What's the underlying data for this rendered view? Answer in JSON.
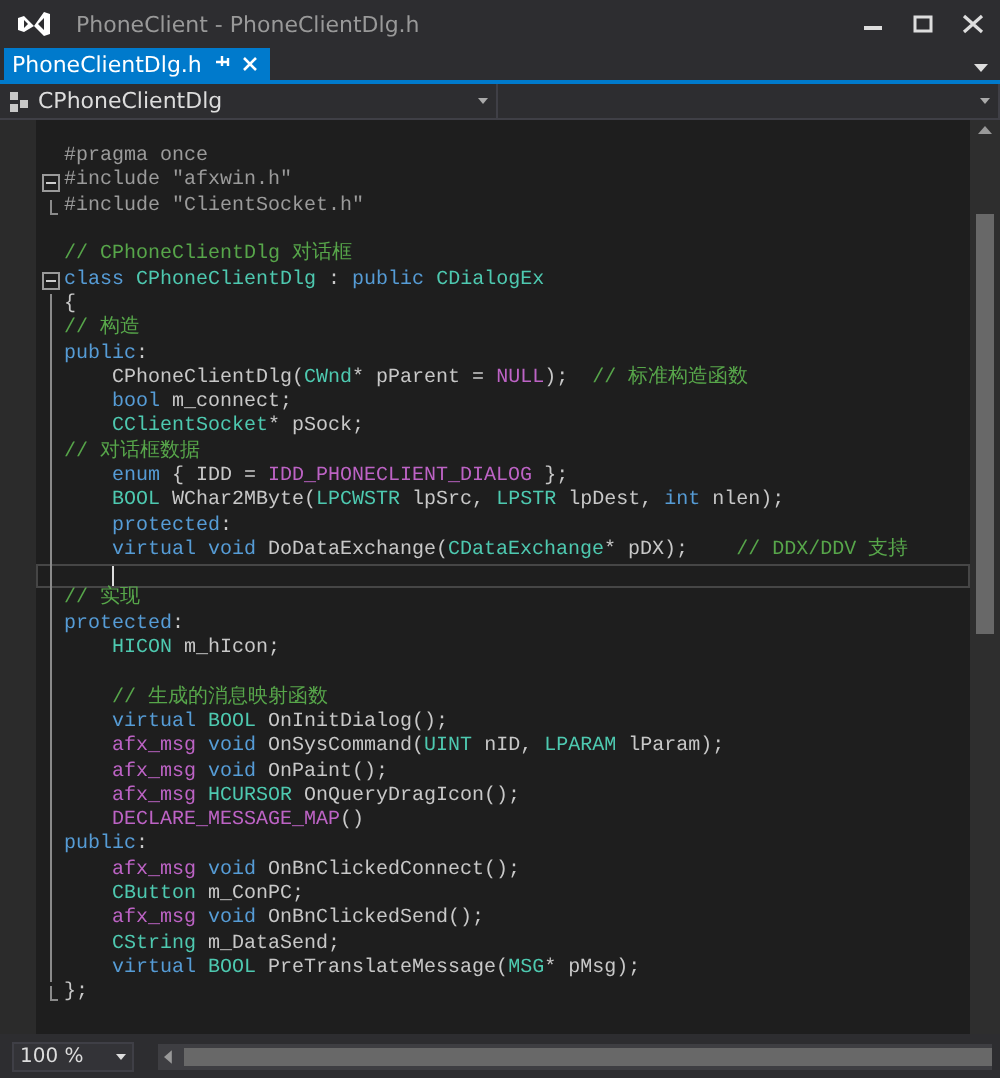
{
  "window": {
    "title": "PhoneClient - PhoneClientDlg.h"
  },
  "tabs": [
    {
      "label": "PhoneClientDlg.h",
      "selected": true,
      "pinned": false
    }
  ],
  "navigation": {
    "scope": "CPhoneClientDlg"
  },
  "editor": {
    "lines": [
      {
        "kind": "plain",
        "current": false,
        "segments": [
          {
            "kind": "pre",
            "text": "#pragma once"
          }
        ]
      },
      {
        "kind": "foldstart",
        "current": false,
        "segments": [
          {
            "kind": "pre",
            "text": "#include \"afxwin.h\""
          }
        ]
      },
      {
        "kind": "foldend",
        "current": false,
        "segments": [
          {
            "kind": "pre",
            "text": "#include \"ClientSocket.h\""
          }
        ]
      },
      {
        "kind": "plain",
        "current": false
      },
      {
        "kind": "plain",
        "current": false,
        "segments": [
          {
            "kind": "comment",
            "text": "// CPhoneClientDlg 对话框"
          }
        ]
      },
      {
        "kind": "foldstart",
        "current": false,
        "segments": [
          {
            "kind": "kw",
            "text": "class "
          },
          {
            "kind": "type",
            "text": "CPhoneClientDlg"
          },
          {
            "kind": "plain",
            "text": " : "
          },
          {
            "kind": "kw",
            "text": "public "
          },
          {
            "kind": "type",
            "text": "CDialogEx"
          }
        ]
      },
      {
        "kind": "guide",
        "current": false,
        "segments": [
          {
            "kind": "plain",
            "text": "{"
          }
        ]
      },
      {
        "kind": "guide",
        "current": false,
        "segments": [
          {
            "kind": "comment",
            "text": "// 构造"
          }
        ]
      },
      {
        "kind": "guide",
        "current": false,
        "segments": [
          {
            "kind": "kw",
            "text": "public"
          },
          {
            "kind": "plain",
            "text": ":"
          }
        ]
      },
      {
        "kind": "guide",
        "current": false,
        "segments": [
          {
            "kind": "plain",
            "text": "    CPhoneClientDlg("
          },
          {
            "kind": "type",
            "text": "CWnd"
          },
          {
            "kind": "plain",
            "text": "* pParent = "
          },
          {
            "kind": "macro",
            "text": "NULL"
          },
          {
            "kind": "plain",
            "text": ");  "
          },
          {
            "kind": "comment",
            "text": "// 标准构造函数"
          }
        ]
      },
      {
        "kind": "guide",
        "current": false,
        "segments": [
          {
            "kind": "kw",
            "text": "    bool"
          },
          {
            "kind": "plain",
            "text": " m_connect;"
          }
        ]
      },
      {
        "kind": "guide",
        "current": false,
        "segments": [
          {
            "kind": "type",
            "text": "    CClientSocket"
          },
          {
            "kind": "plain",
            "text": "* pSock;"
          }
        ]
      },
      {
        "kind": "guide",
        "current": false,
        "segments": [
          {
            "kind": "comment",
            "text": "// 对话框数据"
          }
        ]
      },
      {
        "kind": "guide",
        "current": false,
        "segments": [
          {
            "kind": "kw",
            "text": "    enum"
          },
          {
            "kind": "plain",
            "text": " { IDD = "
          },
          {
            "kind": "macro",
            "text": "IDD_PHONECLIENT_DIALOG"
          },
          {
            "kind": "plain",
            "text": " };"
          }
        ]
      },
      {
        "kind": "guide",
        "current": false,
        "segments": [
          {
            "kind": "type",
            "text": "    BOOL"
          },
          {
            "kind": "plain",
            "text": " WChar2MByte("
          },
          {
            "kind": "type",
            "text": "LPCWSTR"
          },
          {
            "kind": "plain",
            "text": " lpSrc, "
          },
          {
            "kind": "type",
            "text": "LPSTR"
          },
          {
            "kind": "plain",
            "text": " lpDest, "
          },
          {
            "kind": "kw",
            "text": "int"
          },
          {
            "kind": "plain",
            "text": " nlen);"
          }
        ]
      },
      {
        "kind": "guide",
        "current": false,
        "segments": [
          {
            "kind": "kw",
            "text": "    protected"
          },
          {
            "kind": "plain",
            "text": ":"
          }
        ]
      },
      {
        "kind": "guide",
        "current": false,
        "segments": [
          {
            "kind": "kw",
            "text": "    virtual void"
          },
          {
            "kind": "plain",
            "text": " DoDataExchange("
          },
          {
            "kind": "type",
            "text": "CDataExchange"
          },
          {
            "kind": "plain",
            "text": "* pDX);    "
          },
          {
            "kind": "comment",
            "text": "// DDX/DDV 支持"
          }
        ]
      },
      {
        "kind": "guide",
        "current": true
      },
      {
        "kind": "guide",
        "current": false,
        "segments": [
          {
            "kind": "comment",
            "text": "// 实现"
          }
        ]
      },
      {
        "kind": "guide",
        "current": false,
        "segments": [
          {
            "kind": "kw",
            "text": "protected"
          },
          {
            "kind": "plain",
            "text": ":"
          }
        ]
      },
      {
        "kind": "guide",
        "current": false,
        "segments": [
          {
            "kind": "type",
            "text": "    HICON"
          },
          {
            "kind": "plain",
            "text": " m_hIcon;"
          }
        ]
      },
      {
        "kind": "guide",
        "current": false
      },
      {
        "kind": "guide",
        "current": false,
        "segments": [
          {
            "kind": "comment",
            "text": "    // 生成的消息映射函数"
          }
        ]
      },
      {
        "kind": "guide",
        "current": false,
        "segments": [
          {
            "kind": "kw",
            "text": "    virtual "
          },
          {
            "kind": "type",
            "text": "BOOL"
          },
          {
            "kind": "plain",
            "text": " OnInitDialog();"
          }
        ]
      },
      {
        "kind": "guide",
        "current": false,
        "segments": [
          {
            "kind": "macro",
            "text": "    afx_msg "
          },
          {
            "kind": "kw",
            "text": "void"
          },
          {
            "kind": "plain",
            "text": " OnSysCommand("
          },
          {
            "kind": "type",
            "text": "UINT"
          },
          {
            "kind": "plain",
            "text": " nID, "
          },
          {
            "kind": "type",
            "text": "LPARAM"
          },
          {
            "kind": "plain",
            "text": " lParam);"
          }
        ]
      },
      {
        "kind": "guide",
        "current": false,
        "segments": [
          {
            "kind": "macro",
            "text": "    afx_msg "
          },
          {
            "kind": "kw",
            "text": "void"
          },
          {
            "kind": "plain",
            "text": " OnPaint();"
          }
        ]
      },
      {
        "kind": "guide",
        "current": false,
        "segments": [
          {
            "kind": "macro",
            "text": "    afx_msg "
          },
          {
            "kind": "type",
            "text": "HCURSOR"
          },
          {
            "kind": "plain",
            "text": " OnQueryDragIcon();"
          }
        ]
      },
      {
        "kind": "guide",
        "current": false,
        "segments": [
          {
            "kind": "macro",
            "text": "    DECLARE_MESSAGE_MAP"
          },
          {
            "kind": "plain",
            "text": "()"
          }
        ]
      },
      {
        "kind": "guide",
        "current": false,
        "segments": [
          {
            "kind": "kw",
            "text": "public"
          },
          {
            "kind": "plain",
            "text": ":"
          }
        ]
      },
      {
        "kind": "guide",
        "current": false,
        "segments": [
          {
            "kind": "macro",
            "text": "    afx_msg "
          },
          {
            "kind": "kw",
            "text": "void"
          },
          {
            "kind": "plain",
            "text": " OnBnClickedConnect();"
          }
        ]
      },
      {
        "kind": "guide",
        "current": false,
        "segments": [
          {
            "kind": "type",
            "text": "    CButton"
          },
          {
            "kind": "plain",
            "text": " m_ConPC;"
          }
        ]
      },
      {
        "kind": "guide",
        "current": false,
        "segments": [
          {
            "kind": "macro",
            "text": "    afx_msg "
          },
          {
            "kind": "kw",
            "text": "void"
          },
          {
            "kind": "plain",
            "text": " OnBnClickedSend();"
          }
        ]
      },
      {
        "kind": "guide",
        "current": false,
        "segments": [
          {
            "kind": "type",
            "text": "    CString"
          },
          {
            "kind": "plain",
            "text": " m_DataSend;"
          }
        ]
      },
      {
        "kind": "guide",
        "current": false,
        "segments": [
          {
            "kind": "kw",
            "text": "    virtual "
          },
          {
            "kind": "type",
            "text": "BOOL"
          },
          {
            "kind": "plain",
            "text": " PreTranslateMessage("
          },
          {
            "kind": "type",
            "text": "MSG"
          },
          {
            "kind": "plain",
            "text": "* pMsg);"
          }
        ]
      },
      {
        "kind": "foldend",
        "current": false,
        "segments": [
          {
            "kind": "plain",
            "text": "};"
          }
        ]
      }
    ]
  },
  "status_bar": {
    "zoom": "100 %"
  }
}
